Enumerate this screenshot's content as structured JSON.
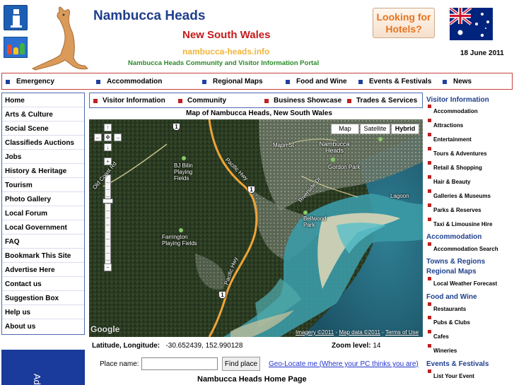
{
  "header": {
    "site_title": "Nambucca Heads",
    "state": "New South Wales",
    "domain": "nambucca-heads.info",
    "tagline": "Nambucca Heads Community and Visitor Information Portal",
    "hotels_button": "Looking for Hotels?",
    "date": "18 June 2011"
  },
  "top_nav": [
    "Emergency",
    "Accommodation",
    "Regional Maps",
    "Food and Wine",
    "Events & Festivals",
    "News"
  ],
  "left_nav": [
    "Home",
    "Arts & Culture",
    "Social Scene",
    "Classifieds Auctions",
    "Jobs",
    "History & Heritage",
    "Tourism",
    "Photo Gallery",
    "Local Forum",
    "Local Government",
    "FAQ",
    "Bookmark This Site",
    "Advertise Here",
    "Contact us",
    "Suggestion Box",
    "Help us",
    "About us"
  ],
  "ad_text": "Ad",
  "sub_nav": [
    "Visitor Information",
    "Community",
    "Business Showcase",
    "Trades & Services"
  ],
  "map": {
    "title": "Map of Nambucca Heads, New South Wales",
    "types": [
      "Map",
      "Satellite",
      "Hybrid"
    ],
    "active_type": "Hybrid",
    "labels": {
      "nambucca_heads": "Nambucca Heads",
      "gordon_park": "Gordon Park",
      "bellwood_park": "Bellwood Park",
      "bj_bilin": "BJ Bilin Playing Fields",
      "farrington": "Farrington Playing Fields",
      "lagoon": "Lagoon",
      "mann_st": "Mann St",
      "pacific_hwy": "Pacific Hwy",
      "pacific_hwy2": "Pacific Hwy",
      "riverside": "Riverside Dr",
      "old_coast": "Old Coast Rd",
      "route": "1"
    },
    "google": "Google",
    "attribution": {
      "imagery": "Imagery ©2011",
      "mapdata": "Map data ©2011",
      "sep": " - ",
      "terms": "Terms of Use"
    }
  },
  "coords": {
    "label": "Latitude, Longitude:",
    "value": "-30.652439, 152.990128",
    "zoom_label": "Zoom level:",
    "zoom_value": "14"
  },
  "search": {
    "label": "Place name:",
    "value": "",
    "button": "Find place",
    "geo_link": "Geo-Locate me (Where your PC thinks you are)"
  },
  "home_title": "Nambucca Heads Home Page",
  "right_col": {
    "sections": [
      {
        "heading": "Visitor Information",
        "items": [
          "Accommodation",
          "Attractions",
          "Entertainment",
          "Tours & Adventures",
          "Retail & Shopping",
          "Hair & Beauty",
          "Galleries & Museums",
          "Parks & Reserves",
          "Taxi & Limousine Hire"
        ]
      },
      {
        "heading": "Accommodation",
        "items": [
          "Accommodation Search"
        ]
      },
      {
        "heading": "Towns & Regions",
        "items": []
      },
      {
        "heading": "Regional Maps",
        "items": [
          "Local Weather Forecast"
        ]
      },
      {
        "heading": "Food and Wine",
        "items": [
          "Restaurants",
          "Pubs & Clubs",
          "Cafes",
          "Wineries"
        ]
      },
      {
        "heading": "Events & Festivals",
        "items": [
          "List Your Event"
        ]
      }
    ]
  },
  "colors": {
    "brand_blue": "#1f3f8c",
    "accent_red": "#c41a1a",
    "domain_gold": "#f0b53a",
    "tagline_green": "#2a8a2a",
    "hotel_orange": "#e8731f"
  }
}
